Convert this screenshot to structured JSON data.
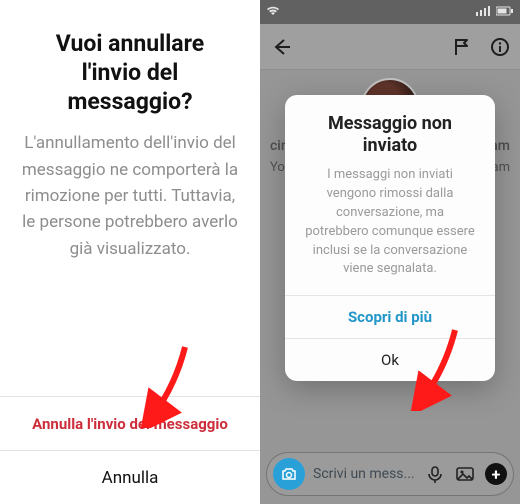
{
  "left_dialog": {
    "title": "Vuoi annullare l'invio del messaggio?",
    "body": "L'annullamento dell'invio del messaggio ne comporterà la rimozione per tutti. Tuttavia, le persone potrebbero averlo già visualizzato.",
    "primary_action": "Annulla l'invio del messaggio",
    "secondary_action": "Annulla"
  },
  "right_screen": {
    "status": {
      "net_icon": "wifi-icon"
    },
    "name_left": "cin",
    "name_right": "am",
    "meta_left": "You",
    "meta_right": "am",
    "composer_placeholder": "Scrivi un mess..."
  },
  "right_modal": {
    "title": "Messaggio non inviato",
    "body": "I messaggi non inviati vengono rimossi dalla conversazione, ma potrebbero comunque essere inclusi se la conversazione viene segnalata.",
    "link": "Scopri di più",
    "ok": "Ok"
  },
  "colors": {
    "danger": "#cc2e3b",
    "link": "#2196c9",
    "camera": "#2aa0d8",
    "arrow": "#ff1a1a"
  }
}
